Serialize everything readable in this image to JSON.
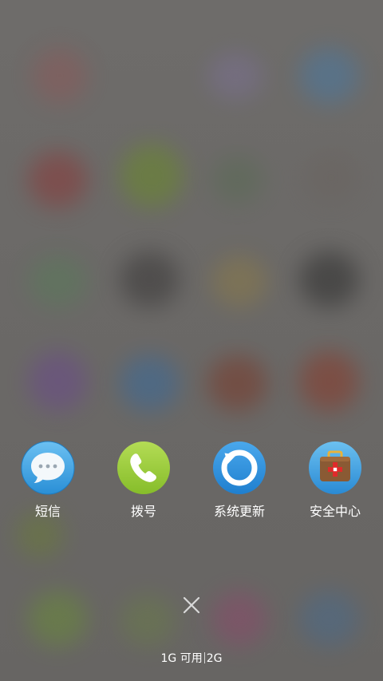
{
  "apps": [
    {
      "label": "短信",
      "icon": "messages-icon",
      "color": "#3aa4e6"
    },
    {
      "label": "拨号",
      "icon": "phone-icon",
      "color": "#9ccd3c"
    },
    {
      "label": "系统更新",
      "icon": "system-update-icon",
      "color": "#2b8fdc"
    },
    {
      "label": "安全中心",
      "icon": "security-center-icon",
      "color": "#3a9ee2"
    }
  ],
  "close": {
    "icon": "close-icon"
  },
  "memory": {
    "available": "1G 可用",
    "total": "2G"
  }
}
